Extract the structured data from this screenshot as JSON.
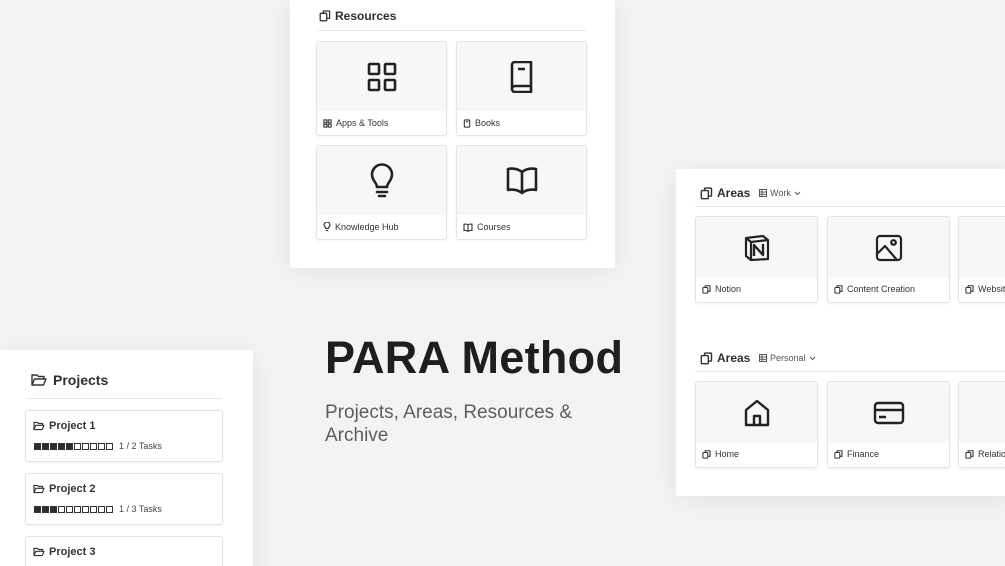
{
  "hero": {
    "title": "PARA Method",
    "subtitle": "Projects, Areas, Resources & Archive"
  },
  "resources": {
    "title": "Resources",
    "title_icon": "copy-icon",
    "cards": [
      {
        "label": "Apps & Tools",
        "icon": "grid-icon"
      },
      {
        "label": "Books",
        "icon": "book-icon"
      },
      {
        "label": "Knowledge Hub",
        "icon": "lightbulb-icon"
      },
      {
        "label": "Courses",
        "icon": "open-book-icon"
      }
    ]
  },
  "areas_work": {
    "title": "Areas",
    "filter": "Work",
    "cards": [
      {
        "label": "Notion",
        "icon": "notion-icon"
      },
      {
        "label": "Content Creation",
        "icon": "image-icon"
      },
      {
        "label": "Websit",
        "icon": "globe-icon"
      }
    ]
  },
  "areas_personal": {
    "title": "Areas",
    "filter": "Personal",
    "cards": [
      {
        "label": "Home",
        "icon": "home-icon"
      },
      {
        "label": "Finance",
        "icon": "credit-card-icon"
      },
      {
        "label": "Relatio",
        "icon": "heart-icon"
      }
    ]
  },
  "projects": {
    "title": "Projects",
    "title_icon": "folder-open-icon",
    "items": [
      {
        "name": "Project 1",
        "progress_text": "1 / 2 Tasks",
        "progress": 0.5
      },
      {
        "name": "Project 2",
        "progress_text": "1 / 3 Tasks",
        "progress": 0.3
      },
      {
        "name": "Project 3",
        "progress_text": "",
        "progress": 0
      }
    ]
  }
}
